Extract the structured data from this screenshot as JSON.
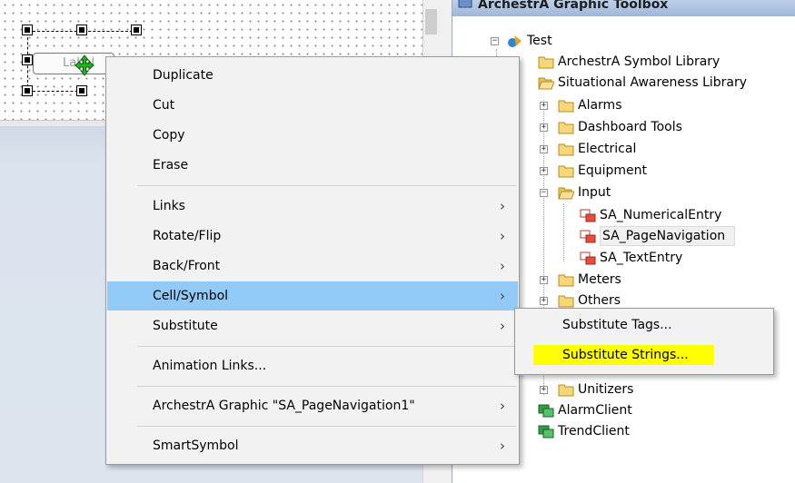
{
  "canvas": {
    "selected_symbol_label": "Label"
  },
  "toolbox": {
    "title": "ArchestrA Graphic Toolbox",
    "tree": [
      {
        "label": "Test",
        "icon": "graphic-toolbox-root-icon",
        "expander": "−"
      },
      {
        "label": "ArchestrA Symbol Library",
        "icon": "folder-icon"
      },
      {
        "label": "Situational Awareness Library",
        "icon": "folder-open-icon"
      },
      {
        "label": "Alarms",
        "icon": "folder-icon",
        "expander": "+"
      },
      {
        "label": "Dashboard Tools",
        "icon": "folder-icon",
        "expander": "+"
      },
      {
        "label": "Electrical",
        "icon": "folder-icon",
        "expander": "+"
      },
      {
        "label": "Equipment",
        "icon": "folder-icon",
        "expander": "+"
      },
      {
        "label": "Input",
        "icon": "folder-open-icon",
        "expander": "−"
      },
      {
        "label": "SA_NumericalEntry",
        "icon": "symbol-icon"
      },
      {
        "label": "SA_PageNavigation",
        "icon": "symbol-icon"
      },
      {
        "label": "SA_TextEntry",
        "icon": "symbol-icon"
      },
      {
        "label": "Meters",
        "icon": "folder-icon",
        "expander": "+"
      },
      {
        "label": "Others",
        "icon": "folder-icon",
        "expander": "+"
      },
      {
        "label": "Unitizers",
        "icon": "folder-icon",
        "expander": "+"
      },
      {
        "label": "AlarmClient",
        "icon": "client-control-icon"
      },
      {
        "label": "TrendClient",
        "icon": "client-control-icon"
      }
    ]
  },
  "context_menu": {
    "items": [
      {
        "label": "Duplicate"
      },
      {
        "label": "Cut"
      },
      {
        "label": "Copy"
      },
      {
        "label": "Erase"
      },
      {
        "label": "Links",
        "submenu_arrow": "›"
      },
      {
        "label": "Rotate/Flip",
        "submenu_arrow": "›"
      },
      {
        "label": "Back/Front",
        "submenu_arrow": "›"
      },
      {
        "label": "Cell/Symbol",
        "submenu_arrow": "›",
        "highlighted": true
      },
      {
        "label": "Substitute",
        "submenu_arrow": "›"
      },
      {
        "label": "Animation Links..."
      },
      {
        "label": "ArchestrA Graphic \"SA_PageNavigation1\"",
        "submenu_arrow": "›"
      },
      {
        "label": "SmartSymbol",
        "submenu_arrow": "›"
      }
    ]
  },
  "submenu": {
    "items": [
      {
        "label": "Substitute Tags..."
      },
      {
        "label": "Substitute Strings...",
        "highlight_color": "#ffff00"
      }
    ]
  },
  "colors": {
    "menu_highlight": "#91c9f7",
    "menu_background": "#f2f2f2",
    "canvas_gray": "#dbe3ee",
    "folder_yellow": "#f5d77a"
  }
}
